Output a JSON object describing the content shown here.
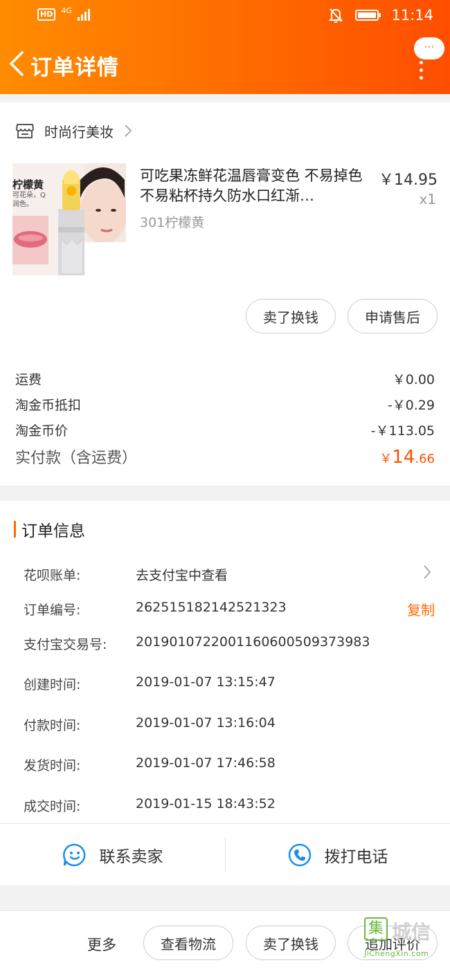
{
  "colors": {
    "accent": "#ff6a00",
    "price": "#ff5000",
    "watermark": "#58b22a"
  },
  "status_bar": {
    "network_label": "HD",
    "signal_label": "4G",
    "time": "11:14"
  },
  "nav": {
    "title": "订单详情",
    "more_bubble": "···"
  },
  "shop": {
    "name": "时尚行美妆"
  },
  "product": {
    "image_caption": "柠檬黄",
    "image_subcaption": "可花朵，Q\n润色。",
    "title": "可吃果冻鲜花温唇膏变色 不易掉色不易粘杯持久防水口红渐…",
    "sku": "301柠檬黄",
    "price": "￥14.95",
    "quantity": "x1"
  },
  "item_actions": {
    "sell_label": "卖了换钱",
    "after_sale_label": "申请售后"
  },
  "fees": [
    {
      "label": "运费",
      "value": "￥0.00"
    },
    {
      "label": "淘金币抵扣",
      "value": "-￥0.29"
    },
    {
      "label": "淘金币价",
      "value": "-￥113.05"
    }
  ],
  "total": {
    "label": "实付款（含运费）",
    "currency": "￥",
    "integer": "14",
    "decimal": ".66"
  },
  "order_info": {
    "title": "订单信息",
    "rows": [
      {
        "label": "花呗账单:",
        "value": "去支付宝中查看"
      },
      {
        "label": "订单编号:",
        "value": "262515182142521323"
      },
      {
        "label": "支付宝交易号:",
        "value": "2019010722001160600509373983"
      },
      {
        "label": "创建时间:",
        "value": "2019-01-07 13:15:47"
      },
      {
        "label": "付款时间:",
        "value": "2019-01-07 13:16:04"
      },
      {
        "label": "发货时间:",
        "value": "2019-01-07 17:46:58"
      },
      {
        "label": "成交时间:",
        "value": "2019-01-15 18:43:52"
      }
    ],
    "copy_label": "复制"
  },
  "contact": {
    "seller_label": "联系卖家",
    "call_label": "拨打电话"
  },
  "bottom_actions": {
    "more_label": "更多",
    "logistics_label": "查看物流",
    "sell_label": "卖了换钱",
    "review_label": "追加评价"
  },
  "watermark": {
    "logo_char": "集",
    "text": "城信",
    "url": "JiChengXin.com"
  }
}
